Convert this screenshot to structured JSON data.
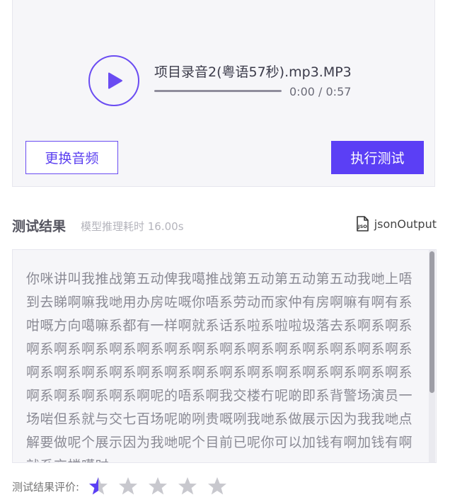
{
  "player": {
    "file_name": "项目录音2(粤语57秒).mp3.MP3",
    "current_time": "0:00",
    "separator": " / ",
    "duration": "0:57",
    "progress": 0.0,
    "replace_label": "更换音频",
    "run_label": "执行测试"
  },
  "result": {
    "title": "测试结果",
    "timing": "模型推理耗时 16.00s",
    "json_label": "jsonOutput",
    "text": "你咪讲叫我推战第五动俾我噶推战第五动第五动第五动我哋上唔到去睇啊嘛我哋用办房咗嘅你唔系劳动而家仲有房啊嘛有啊有系咁嘅方向噶嘛系都有一样啊就系话系啦系啦啦圾落去系啊系啊系啊系啊系啊系啊系啊系啊系啊系啊系啊系啊系啊系啊系啊系啊系啊系啊系啊系啊系啊系啊系啊系啊系啊系啊系啊系啊系啊系啊系啊系啊系啊系啊系啊呢的唔系啊我交楼冇呢啲即系背警场演员一场啱但系就与交七百场呢啲咧贵嘅咧我哋系做展示因为我我哋点解要做呢个展示因为我哋呢个目前已呢你可以加钱有啊加钱有啊就系交楼噶时"
  },
  "rating": {
    "label": "测试结果评价:",
    "value": 0.5,
    "max": 5
  },
  "colors": {
    "accent": "#5b3ff5",
    "star_empty": "#c8c8ce"
  },
  "icons": {
    "play": "play-icon",
    "json": "json-file-icon",
    "star": "star-icon"
  }
}
